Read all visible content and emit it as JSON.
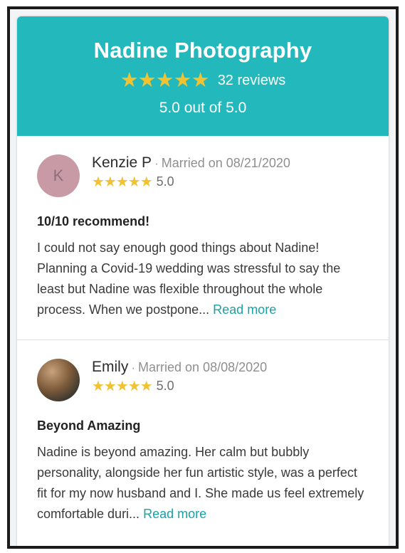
{
  "header": {
    "title": "Nadine Photography",
    "stars": "★★★★★",
    "review_count": "32 reviews",
    "score_text": "5.0 out of 5.0"
  },
  "reviews": [
    {
      "avatar_letter": "K",
      "name": "Kenzie P",
      "separator": "·",
      "married": "Married on 08/21/2020",
      "stars": "★★★★★",
      "rating": "5.0",
      "title": "10/10 recommend!",
      "body": "I could not say enough good things about Nadine! Planning a Covid-19 wedding was stressful to say the least but Nadine was flexible throughout the whole process. When we postpone...",
      "read_more": "Read more"
    },
    {
      "avatar_letter": "",
      "name": "Emily",
      "separator": "·",
      "married": "Married on 08/08/2020",
      "stars": "★★★★★",
      "rating": "5.0",
      "title": "Beyond Amazing",
      "body": "Nadine is beyond amazing. Her calm but bubbly personality, alongside her fun artistic style, was a perfect fit for my now husband and I. She made us feel extremely comfortable duri...",
      "read_more": "Read more"
    }
  ],
  "colors": {
    "header_bg": "#23b8bb",
    "star": "#f1c232",
    "link": "#1aa2a6"
  }
}
